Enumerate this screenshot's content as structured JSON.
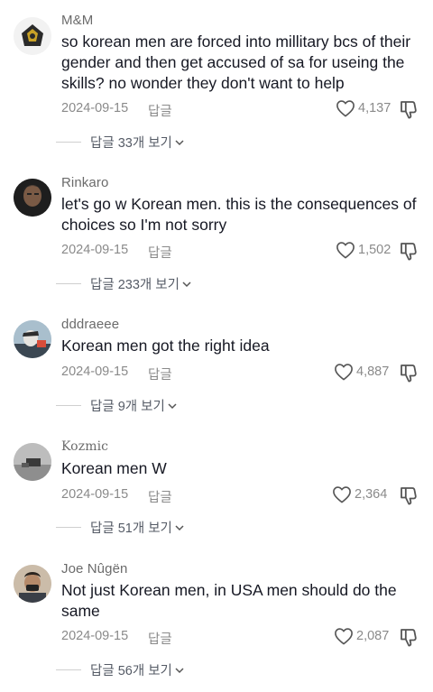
{
  "comments": [
    {
      "username": "M&M",
      "text": "so korean men are forced into millitary bcs of their gender and then get accused of sa for useing the skills? no wonder they don't want to help",
      "date": "2024-09-15",
      "reply_label": "답글",
      "likes": "4,137",
      "view_replies": "답글 33개 보기"
    },
    {
      "username": "Rinkaro",
      "text": "let's go w Korean men. this is the consequences of choices so I'm not sorry",
      "date": "2024-09-15",
      "reply_label": "답글",
      "likes": "1,502",
      "view_replies": "답글 233개 보기"
    },
    {
      "username": "dddraeee",
      "text": "Korean men got the right idea",
      "date": "2024-09-15",
      "reply_label": "답글",
      "likes": "4,887",
      "view_replies": "답글 9개 보기"
    },
    {
      "username": "Kozmic",
      "text": "Korean men W",
      "date": "2024-09-15",
      "reply_label": "답글",
      "likes": "2,364",
      "view_replies": "답글 51개 보기"
    },
    {
      "username": "Joe Nûgën",
      "text": "Not just Korean men, in USA men should do the same",
      "date": "2024-09-15",
      "reply_label": "답글",
      "likes": "2,087",
      "view_replies": "답글 56개 보기"
    }
  ],
  "icons": {
    "like": "heart-outline-icon",
    "dislike": "thumbs-down-outline-icon",
    "expand": "chevron-down-icon"
  },
  "colors": {
    "text": "#161823",
    "muted": "#8a8a8a",
    "username": "#6b6b6b"
  }
}
